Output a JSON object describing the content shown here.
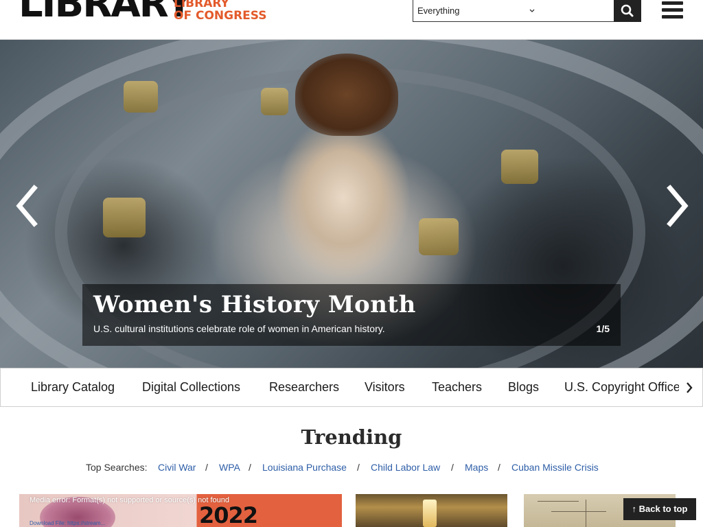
{
  "header": {
    "logo_library": "LIBRARY",
    "logo_loc_line1": "LIBRARY",
    "logo_loc_line2": "OF CONGRESS",
    "search_scope": "Everything",
    "search_placeholder": "",
    "icons": {
      "search": "search-icon",
      "menu": "hamburger-icon",
      "dropdown": "chevron-down-icon"
    }
  },
  "hero": {
    "title": "Women's History Month",
    "subtitle": "U.S. cultural institutions celebrate role of women in American history.",
    "counter": "1/5",
    "icons": {
      "prev": "chevron-left-icon",
      "next": "chevron-right-icon"
    }
  },
  "nav": {
    "items": [
      "Library Catalog",
      "Digital Collections",
      "Researchers",
      "Visitors",
      "Teachers",
      "Blogs",
      "U.S. Copyright Office"
    ],
    "icons": {
      "scroll_right": "chevron-right-icon"
    }
  },
  "trending": {
    "title": "Trending",
    "label": "Top Searches:",
    "separator": "/",
    "links": [
      "Civil War",
      "WPA",
      "Louisiana Purchase",
      "Child Labor Law",
      "Maps",
      "Cuban Missile Crisis"
    ]
  },
  "cards": {
    "card1": {
      "media_error": "Media error: Format(s) not supported or source(s) not found",
      "download": "Download File: https://stream...",
      "year": "2022"
    }
  },
  "back_to_top": {
    "label": "Back to top",
    "icon": "arrow-up-icon"
  },
  "colors": {
    "accent": "#e35a2b",
    "link": "#2e5ea8",
    "dark": "#222222"
  }
}
